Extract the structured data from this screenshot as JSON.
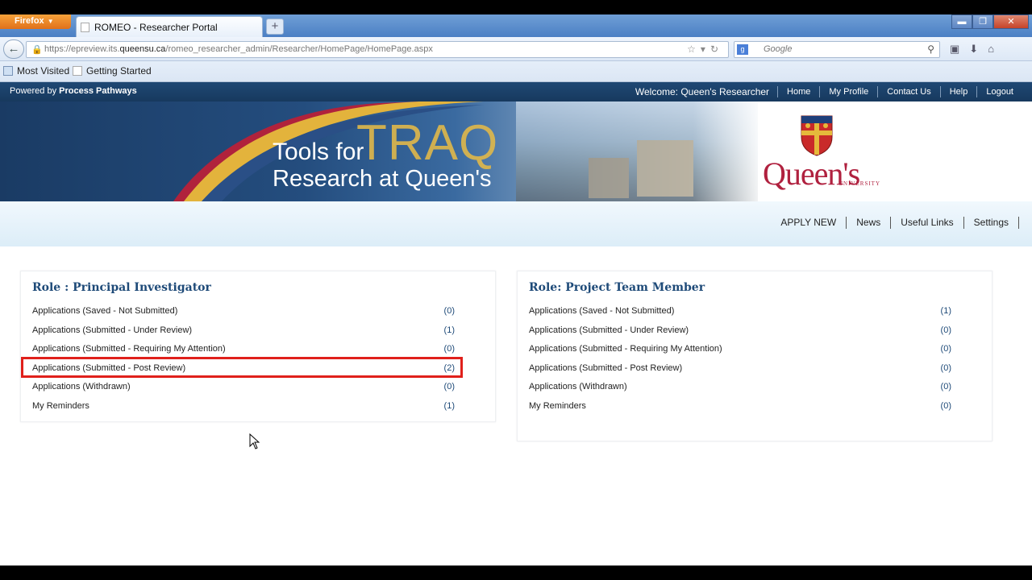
{
  "browser": {
    "menu_label": "Firefox",
    "tab_title": "ROMEO - Researcher Portal",
    "url_prefix": "https://epreview.its.",
    "url_host": "queensu.ca",
    "url_path": "/romeo_researcher_admin/Researcher/HomePage/HomePage.aspx",
    "search_placeholder": "Google",
    "bookmarks": [
      "Most Visited",
      "Getting Started"
    ]
  },
  "topbar": {
    "powered_prefix": "Powered by",
    "powered_brand": "Process Pathways",
    "welcome": "Welcome: Queen's Researcher",
    "links": [
      "Home",
      "My Profile",
      "Contact Us",
      "Help",
      "Logout"
    ]
  },
  "banner": {
    "line1": "Tools for",
    "logo": "TRAQ",
    "line2": "Research at Queen's",
    "university": "Queen's",
    "university_sub": "UNIVERSITY"
  },
  "subnav": [
    "APPLY NEW",
    "News",
    "Useful Links",
    "Settings"
  ],
  "pi_panel": {
    "title": "Role : Principal Investigator",
    "rows": [
      {
        "label": "Applications (Saved - Not Submitted)",
        "count": "(0)"
      },
      {
        "label": "Applications (Submitted - Under Review)",
        "count": "(1)"
      },
      {
        "label": "Applications (Submitted - Requiring My Attention)",
        "count": "(0)"
      },
      {
        "label": "Applications (Submitted - Post Review)",
        "count": "(2)"
      },
      {
        "label": "Applications (Withdrawn)",
        "count": "(0)"
      },
      {
        "label": "My Reminders",
        "count": "(1)"
      }
    ]
  },
  "ptm_panel": {
    "title": "Role: Project Team Member",
    "rows": [
      {
        "label": "Applications (Saved - Not Submitted)",
        "count": "(1)"
      },
      {
        "label": "Applications (Submitted - Under Review)",
        "count": "(0)"
      },
      {
        "label": "Applications (Submitted - Requiring My Attention)",
        "count": "(0)"
      },
      {
        "label": "Applications (Submitted - Post Review)",
        "count": "(0)"
      },
      {
        "label": "Applications (Withdrawn)",
        "count": "(0)"
      },
      {
        "label": "My Reminders",
        "count": "(0)"
      }
    ]
  },
  "colors": {
    "topbar": "#1f4874",
    "panel_title": "#1e4a78",
    "highlight": "#e0201b",
    "queens_red": "#b0213f"
  }
}
